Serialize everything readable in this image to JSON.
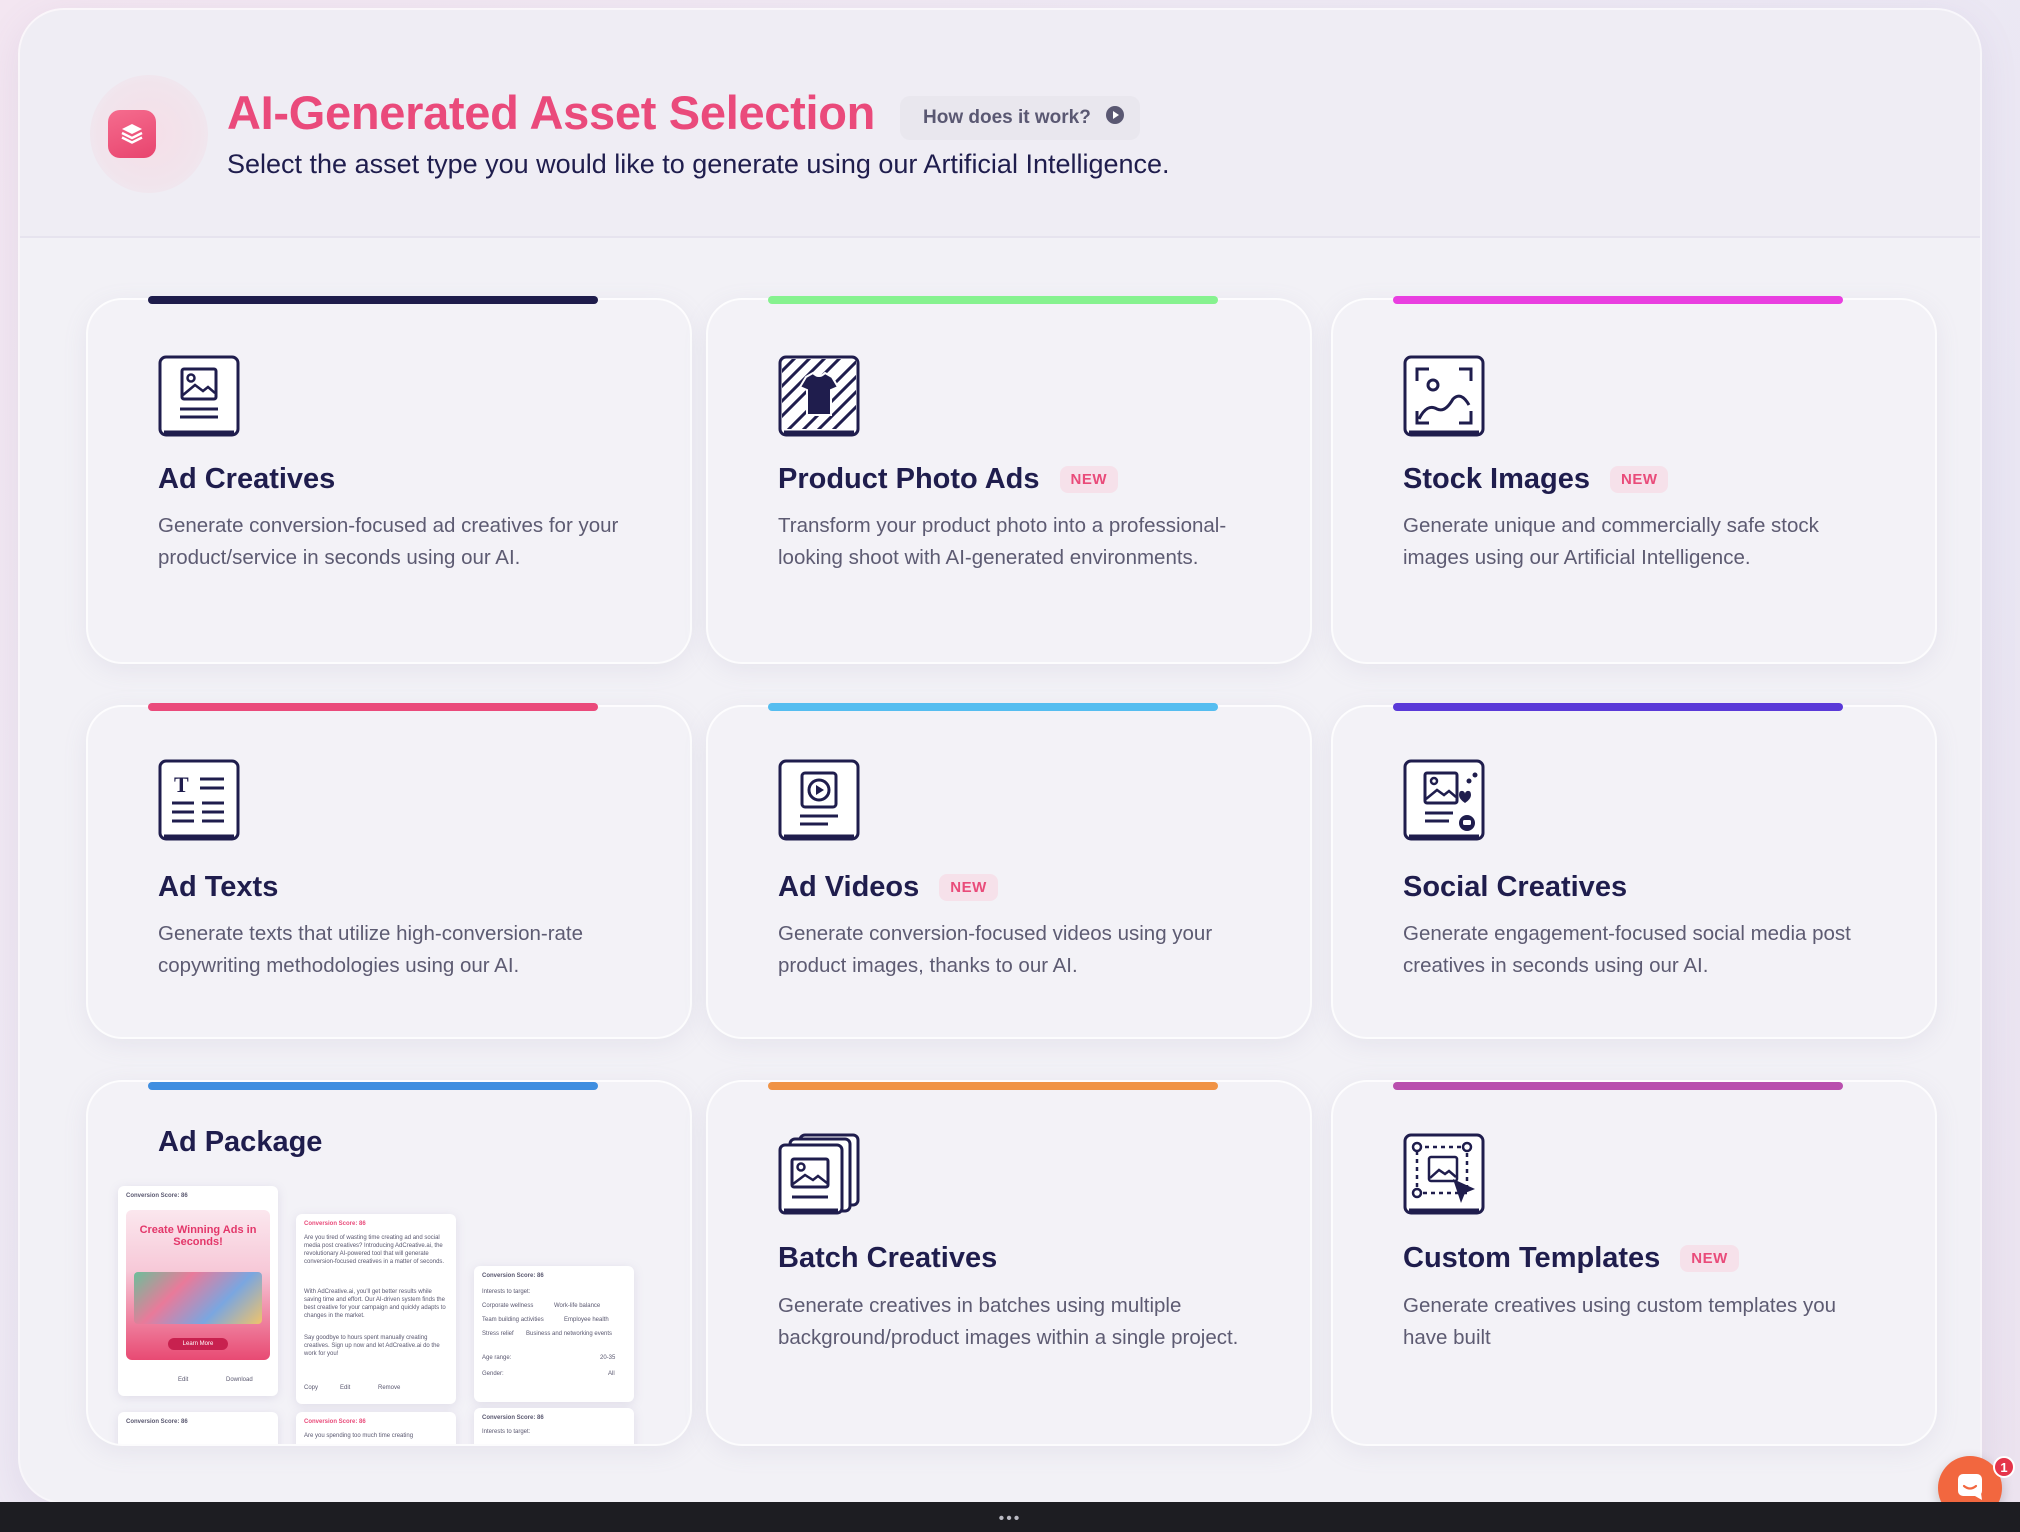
{
  "header": {
    "title": "AI-Generated Asset Selection",
    "how_it_works": "How does it work?",
    "subtitle": "Select the asset type you would like to generate using our Artificial Intelligence."
  },
  "cards": [
    {
      "title": "Ad Creatives",
      "badge": "",
      "description": "Generate conversion-focused ad creatives for your product/service in seconds using our AI.",
      "accent": "#1e1c4b",
      "icon": "image-document-icon"
    },
    {
      "title": "Product Photo Ads",
      "badge": "NEW",
      "description": "Transform your product photo into a professional-looking shoot with AI-generated environments.",
      "accent": "#86f28f",
      "icon": "tshirt-photo-icon"
    },
    {
      "title": "Stock Images",
      "badge": "NEW",
      "description": "Generate unique and commercially safe stock images using our Artificial Intelligence.",
      "accent": "#e93fe0",
      "icon": "stock-image-icon"
    },
    {
      "title": "Ad Texts",
      "badge": "",
      "description": "Generate texts that utilize high-conversion-rate copywriting methodologies using our AI.",
      "accent": "#ea4a7b",
      "icon": "text-document-icon"
    },
    {
      "title": "Ad Videos",
      "badge": "NEW",
      "description": "Generate conversion-focused videos using your product images, thanks to our AI.",
      "accent": "#55bdf0",
      "icon": "video-document-icon"
    },
    {
      "title": "Social Creatives",
      "badge": "",
      "description": "Generate engagement-focused social media post creatives in seconds using our AI.",
      "accent": "#5a39d8",
      "icon": "social-post-icon"
    },
    {
      "title": "Ad Package",
      "badge": "",
      "description": "",
      "accent": "#3f8ee0",
      "icon": ""
    },
    {
      "title": "Batch Creatives",
      "badge": "",
      "description": "Generate creatives in batches using multiple background/product images within a single project.",
      "accent": "#f09345",
      "icon": "batch-images-icon"
    },
    {
      "title": "Custom Templates",
      "badge": "NEW",
      "description": "Generate creatives using custom templates you have built",
      "accent": "#b94fae",
      "icon": "custom-template-icon"
    }
  ],
  "package_preview": {
    "score_label": "Conversion Score: 86",
    "ad_title": "Create Winning Ads in Seconds!",
    "ad_button": "Learn More",
    "edit_label": "Edit",
    "download_label": "Download",
    "copy_label": "Copy",
    "remove_label": "Remove",
    "body_text": "Are you tired of wasting time creating ad and social media post creatives? Introducing AdCreative.ai, the revolutionary AI-powered tool that will generate conversion-focused creatives in a matter of seconds.",
    "body_text_2": "With AdCreative.ai, you'll get better results while saving time and effort. Our AI-driven system finds the best creative for your campaign and quickly adapts to changes in the market.",
    "body_text_3": "Say goodbye to hours spent manually creating creatives. Sign up now and let AdCreative.ai do the work for you!",
    "interests_label": "Interests to target:",
    "interests": [
      "Corporate wellness",
      "Work-life balance",
      "Team building activities",
      "Employee health",
      "Stress relief",
      "Business and networking events"
    ],
    "age_label": "Age range:",
    "age_value": "20-35",
    "gender_label": "Gender:",
    "gender_value": "All",
    "question_text": "Are you spending too much time creating"
  },
  "chat": {
    "unread": "1"
  },
  "taskbar": {
    "dots": "•••"
  }
}
